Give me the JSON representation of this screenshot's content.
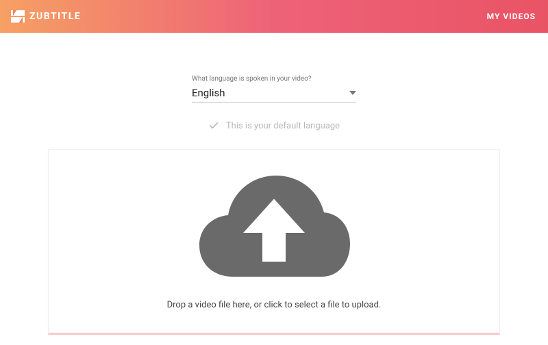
{
  "header": {
    "brand": "ZUBTITLE",
    "nav_my_videos": "MY VIDEOS"
  },
  "language": {
    "prompt": "What language is spoken in your video?",
    "selected": "English",
    "default_note": "This is your default language"
  },
  "dropzone": {
    "instruction": "Drop a video file here, or click to select a file to upload."
  },
  "icons": {
    "logo": "zubtitle-logo-icon",
    "dropdown_caret": "chevron-down-icon",
    "check": "check-icon",
    "cloud_upload": "cloud-upload-icon"
  },
  "colors": {
    "gradient_start": "#f6a063",
    "gradient_end": "#e95465",
    "cloud": "#6a6a6a"
  }
}
